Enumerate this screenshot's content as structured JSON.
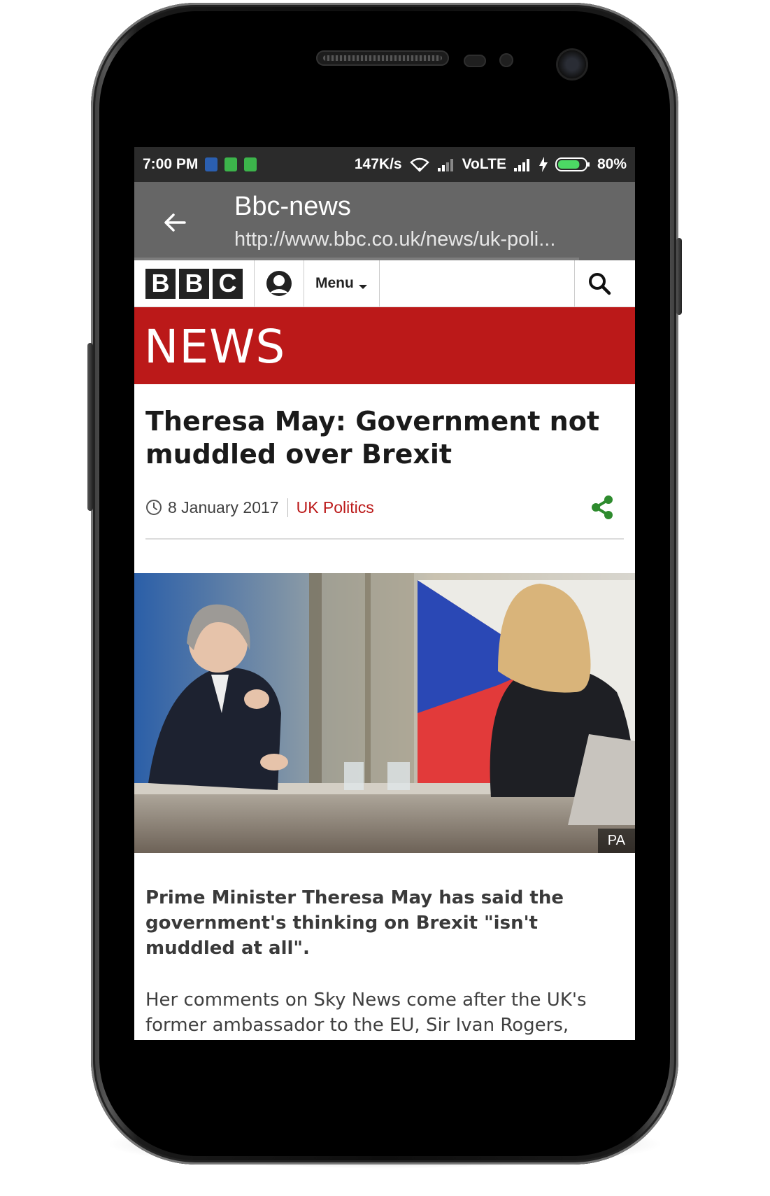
{
  "status_bar": {
    "time": "7:00 PM",
    "speed": "147K/s",
    "network": "VoLTE",
    "battery": "80%",
    "battery_fill": 0.8
  },
  "app_bar": {
    "title": "Bbc-news",
    "url": "http://www.bbc.co.uk/news/uk-poli..."
  },
  "bbc_bar": {
    "logo_letters": [
      "B",
      "B",
      "C"
    ],
    "menu_label": "Menu"
  },
  "news_band": {
    "label": "NEWS"
  },
  "article": {
    "headline": "Theresa May: Government not muddled over Brexit",
    "date": "8 January 2017",
    "category": "UK Politics",
    "image_credit": "PA",
    "lede": "Prime Minister Theresa May has said the government's thinking on Brexit \"isn't muddled at all\".",
    "paragraph": "Her comments on Sky News come after the UK's former ambassador to the EU, Sir Ivan Rogers, criticised ministers' approach to negotiations."
  },
  "colors": {
    "bbc_red": "#bb1919",
    "app_bar": "#666666",
    "status_bar": "#2b2b2b",
    "share_green": "#2e8b2e"
  }
}
